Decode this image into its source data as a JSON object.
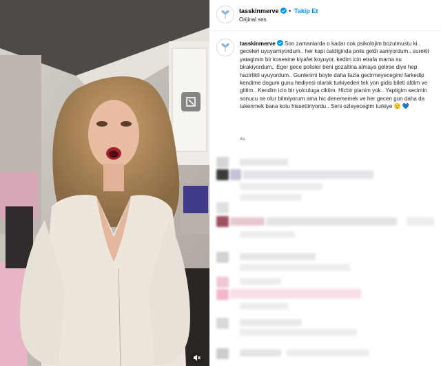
{
  "post": {
    "username": "tasskinmerve",
    "follow_label": "Takip Et",
    "separator": "•",
    "audio": "Orijinal ses",
    "caption_text": "Son zamanlarda o kadar cok psikolojim bozulmustu ki.. geceleri uyuyamiyordum.. her kapi caldiginda polis geldi saniyordum.. surekli yatagimin bir kosesine kiyafet koyuyor, kedim icin etrafa mama su birakiyordum.. Eger gece polisler beni gozaltina almaya gelirse diye hep hazirlikli uyuyordum.. Gunlerimi boyle daha fazla gecirmeyecegimi farkedip kendime dogum gunu hediyesi olarak turkiyeden tek yon gidis bileti aldim ve gittim.. Kendim icin bir yolculuga ciktim. Hicbir planim yok.. Yaptigim secimin sonucu ne olur bilmiyorum ama hic denememek ve her gecen gun daha da tukenmek bana kotu hissettiriyordu.. Seni ozleyecegim turkiye",
    "caption_emoji": "😌 💙",
    "time_ago": "4s"
  },
  "colors": {
    "accent": "#0095f6",
    "text": "#262626",
    "muted": "#737373"
  },
  "icons": {
    "verified": "verified-badge-icon",
    "avatar": "avatar-logo-icon",
    "media_action": "media-action-icon",
    "mute": "speaker-muted-icon"
  }
}
